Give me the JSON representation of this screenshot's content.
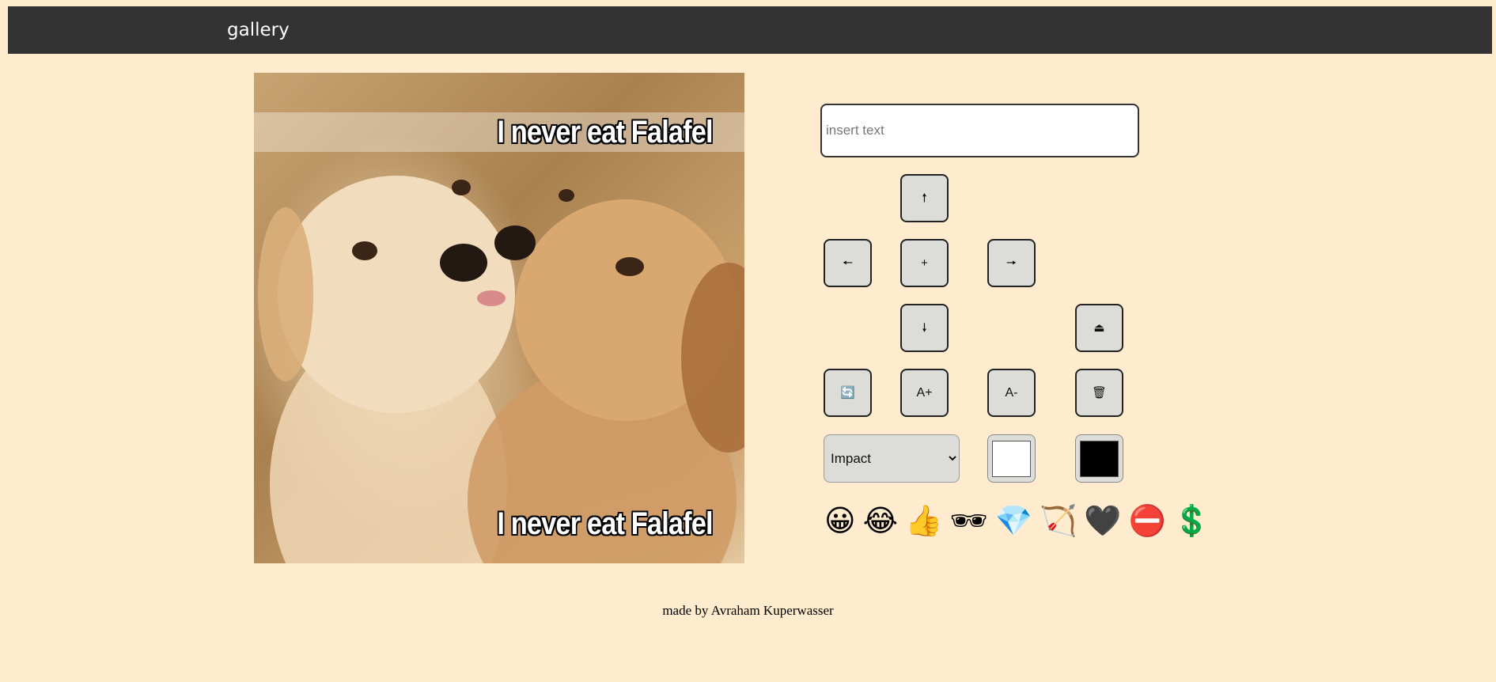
{
  "header": {
    "title": "gallery"
  },
  "meme": {
    "top_text": "I never eat Falafel",
    "bottom_text": "I never eat Falafel"
  },
  "editor": {
    "text_input": {
      "placeholder": "insert text",
      "value": ""
    },
    "buttons": {
      "move_up": "🠕",
      "move_left": "🠔",
      "add_line": "+",
      "move_right": "🠖",
      "move_down": "🠗",
      "save": "⏏",
      "switch_line": "🔄",
      "increase_font": "A+",
      "decrease_font": "A-",
      "delete": "🗑"
    },
    "font_select": {
      "selected": "Impact",
      "options": [
        "Impact"
      ]
    },
    "stroke_color": "#ffffff",
    "fill_color": "#000000",
    "stickers": [
      "😀",
      "😂",
      "👍",
      "🕶",
      "💎",
      "🏹",
      "🖤",
      "⛔",
      "💲"
    ]
  },
  "footer": {
    "credit": "made by Avraham Kuperwasser"
  }
}
